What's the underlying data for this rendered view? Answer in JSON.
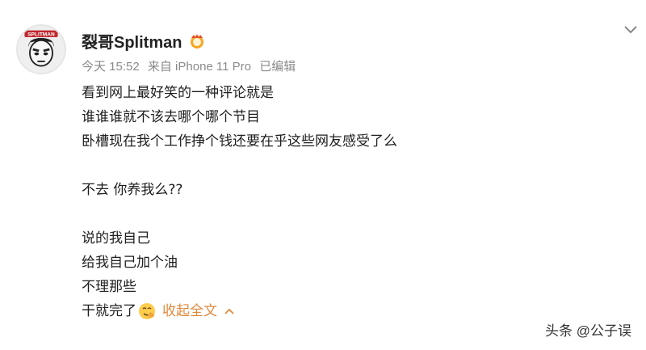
{
  "post": {
    "username": "裂哥Splitman",
    "meta": {
      "time": "今天 15:52",
      "source": "来自 iPhone 11 Pro",
      "edited": "已编辑"
    },
    "avatar_text": "SPLITMAN",
    "lines": [
      "看到网上最好笑的一种评论就是",
      "谁谁谁就不该去哪个哪个节目",
      "卧槽现在我个工作挣个钱还要在乎这些网友感受了么",
      "不去 你养我么??",
      "说的我自己",
      "给我自己加个油",
      "不理那些",
      "干就完了"
    ],
    "collapse_label": "收起全文"
  },
  "watermark": "头条 @公子误",
  "icons": {
    "avatar": "cartoon-face-avatar",
    "badge": "vip-badge-icon",
    "chevron": "chevron-down-icon",
    "emoji": "smirk-emoji-icon",
    "collapse": "chevron-up-icon"
  },
  "colors": {
    "link": "#e08a3c",
    "meta": "#8a8a8a"
  }
}
